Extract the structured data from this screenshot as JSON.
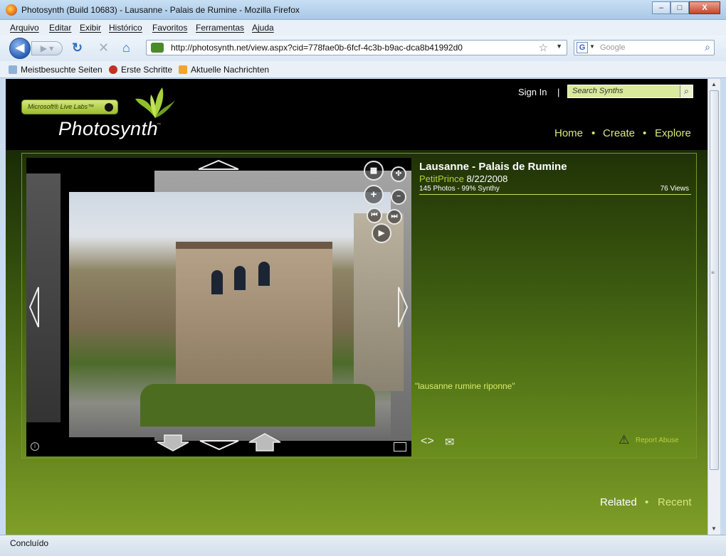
{
  "window": {
    "title": "Photosynth (Build 10683) - Lausanne - Palais de Rumine - Mozilla Firefox",
    "buttons": {
      "minimize": "–",
      "maximize": "□",
      "close": "X"
    }
  },
  "menu": [
    "Arquivo",
    "Editar",
    "Exibir",
    "Histórico",
    "Favoritos",
    "Ferramentas",
    "Ajuda"
  ],
  "navigation": {
    "url": "http://photosynth.net/view.aspx?cid=778fae0b-6fcf-4c3b-b9ac-dca8b41992d0",
    "search_engine_letter": "G",
    "search_placeholder": "Google"
  },
  "bookmarks": [
    "Meistbesuchte Seiten",
    "Erste Schritte",
    "Aktuelle Nachrichten"
  ],
  "site": {
    "badge": "Microsoft® Live Labs™",
    "logo": "Photosynth",
    "logo_tm": "™",
    "sign_in": "Sign In",
    "sign_in_sep": "|",
    "search_placeholder": "Search Synths",
    "top_nav": [
      "Home",
      "Create",
      "Explore"
    ],
    "bottom_nav": [
      "Related",
      "Recent"
    ]
  },
  "synth": {
    "title": "Lausanne - Palais de Rumine",
    "author": "PetitPrince",
    "date": "8/22/2008",
    "stats": "145 Photos - 99% Synthy",
    "views": "76 Views",
    "tags": "\"lausanne rumine riponne\"",
    "report": "Report Abuse"
  },
  "status": "Concluído",
  "colors": {
    "accent": "#d7e87a",
    "link_green": "#b5d23a",
    "panel_dark": "#203206",
    "panel_light": "#6b8e1e"
  },
  "icons": [
    "firefox-icon",
    "back-icon",
    "forward-icon",
    "reload-icon",
    "stop-icon",
    "home-icon",
    "star-icon",
    "magnifier-icon",
    "grid-icon",
    "zoom-in-icon",
    "zoom-out-icon",
    "play-icon",
    "embed-icon",
    "email-icon",
    "warning-icon"
  ]
}
